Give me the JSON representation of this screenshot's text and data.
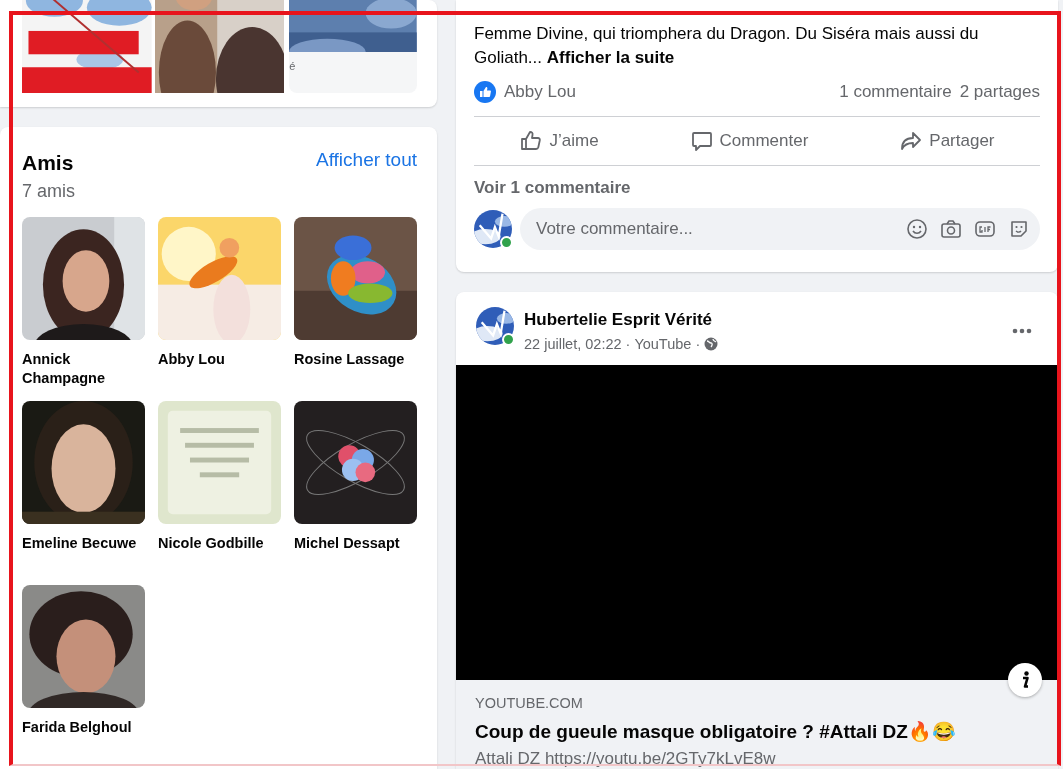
{
  "photos_card": {
    "tiles": [
      {
        "kind": "picture"
      },
      {
        "kind": "picture"
      },
      {
        "kind": "captioned",
        "caption": "é"
      }
    ]
  },
  "friends": {
    "title": "Amis",
    "count": "7 amis",
    "see_all": "Afficher tout",
    "items": [
      {
        "name": "Annick Champagne"
      },
      {
        "name": "Abby Lou"
      },
      {
        "name": "Rosine Lassage"
      },
      {
        "name": "Emeline Becuwe"
      },
      {
        "name": "Nicole Godbille"
      },
      {
        "name": "Michel Dessapt"
      },
      {
        "name": "Farida Belghoul"
      }
    ]
  },
  "post_1": {
    "text_lines": [
      "Femme Divine, qui triomphera du Dragon. Du Siséra mais aussi du",
      "Goliath..."
    ],
    "more_link": "Afficher la suite",
    "reactors": "Abby Lou",
    "comments_count": "1 commentaire",
    "shares_count": "2 partages",
    "actions": [
      {
        "kind": "like",
        "label": "J’aime"
      },
      {
        "kind": "comment",
        "label": "Commenter"
      },
      {
        "kind": "share",
        "label": "Partager"
      }
    ],
    "view_comments": "Voir 1 commentaire",
    "comment_box": {
      "placeholder": "Votre commentaire...",
      "online": true
    }
  },
  "post_2": {
    "author": "Hubertelie Esprit Vérité",
    "online": true,
    "date": "22 juillet, 02:22",
    "separator": "·",
    "source": "YouTube",
    "link": {
      "domain": "YOUTUBE.COM",
      "title": "Coup de gueule masque obligatoire ? #Attali DZ🔥😂",
      "description": "Attali DZ https://youtu.be/2GTy7kLvE8w"
    }
  }
}
